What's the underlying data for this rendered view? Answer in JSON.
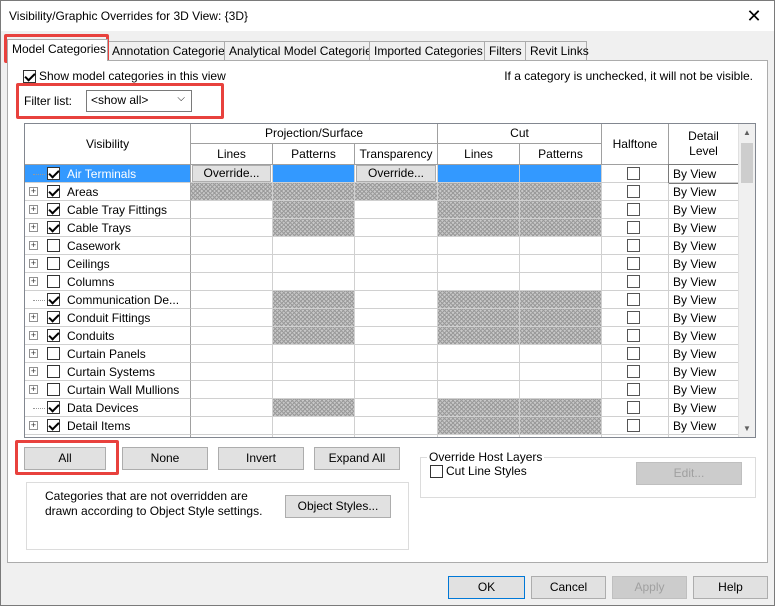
{
  "window": {
    "title": "Visibility/Graphic Overrides for 3D View: {3D}",
    "close_glyph": "✕"
  },
  "tabs": [
    {
      "label": "Model Categories",
      "active": true
    },
    {
      "label": "Annotation Categories"
    },
    {
      "label": "Analytical Model Categories"
    },
    {
      "label": "Imported Categories"
    },
    {
      "label": "Filters"
    },
    {
      "label": "Revit Links"
    }
  ],
  "show_model_label": "Show model categories in this view",
  "info_text": "If a category is unchecked, it will not be visible.",
  "filter": {
    "label": "Filter list:",
    "value": "<show all>"
  },
  "grid": {
    "headers": {
      "visibility": "Visibility",
      "projection": "Projection/Surface",
      "lines": "Lines",
      "patterns": "Patterns",
      "transparency": "Transparency",
      "cut": "Cut",
      "cut_lines": "Lines",
      "cut_patterns": "Patterns",
      "halftone": "Halftone",
      "detail_level": "Detail\nLevel"
    },
    "override_label": "Override...",
    "rows": [
      {
        "name": "Air Terminals",
        "checked": true,
        "expandable": false,
        "selected": true,
        "detail": "By View"
      },
      {
        "name": "Areas",
        "checked": true,
        "expandable": true,
        "detail": "By View"
      },
      {
        "name": "Cable Tray Fittings",
        "checked": true,
        "expandable": true,
        "detail": "By View"
      },
      {
        "name": "Cable Trays",
        "checked": true,
        "expandable": true,
        "detail": "By View"
      },
      {
        "name": "Casework",
        "checked": false,
        "expandable": true,
        "detail": "By View"
      },
      {
        "name": "Ceilings",
        "checked": false,
        "expandable": true,
        "detail": "By View"
      },
      {
        "name": "Columns",
        "checked": false,
        "expandable": true,
        "detail": "By View"
      },
      {
        "name": "Communication De...",
        "checked": true,
        "expandable": false,
        "detail": "By View"
      },
      {
        "name": "Conduit Fittings",
        "checked": true,
        "expandable": true,
        "detail": "By View"
      },
      {
        "name": "Conduits",
        "checked": true,
        "expandable": true,
        "detail": "By View"
      },
      {
        "name": "Curtain Panels",
        "checked": false,
        "expandable": true,
        "detail": "By View"
      },
      {
        "name": "Curtain Systems",
        "checked": false,
        "expandable": true,
        "detail": "By View"
      },
      {
        "name": "Curtain Wall Mullions",
        "checked": false,
        "expandable": true,
        "detail": "By View"
      },
      {
        "name": "Data Devices",
        "checked": true,
        "expandable": false,
        "detail": "By View"
      },
      {
        "name": "Detail Items",
        "checked": true,
        "expandable": true,
        "detail": "By View"
      },
      {
        "name": "",
        "checked": false,
        "expandable": true,
        "detail": "By View"
      }
    ]
  },
  "buttons": {
    "all": "All",
    "none": "None",
    "invert": "Invert",
    "expand_all": "Expand All",
    "object_styles": "Object Styles...",
    "edit": "Edit...",
    "ok": "OK",
    "cancel": "Cancel",
    "apply": "Apply",
    "help": "Help"
  },
  "notice": "Categories that are not overridden are drawn according to Object Style settings.",
  "override_host": {
    "title": "Override Host Layers",
    "cut_line_styles": "Cut Line Styles"
  },
  "colors": {
    "selection": "#3399ff",
    "highlight_box": "#e8413d"
  }
}
